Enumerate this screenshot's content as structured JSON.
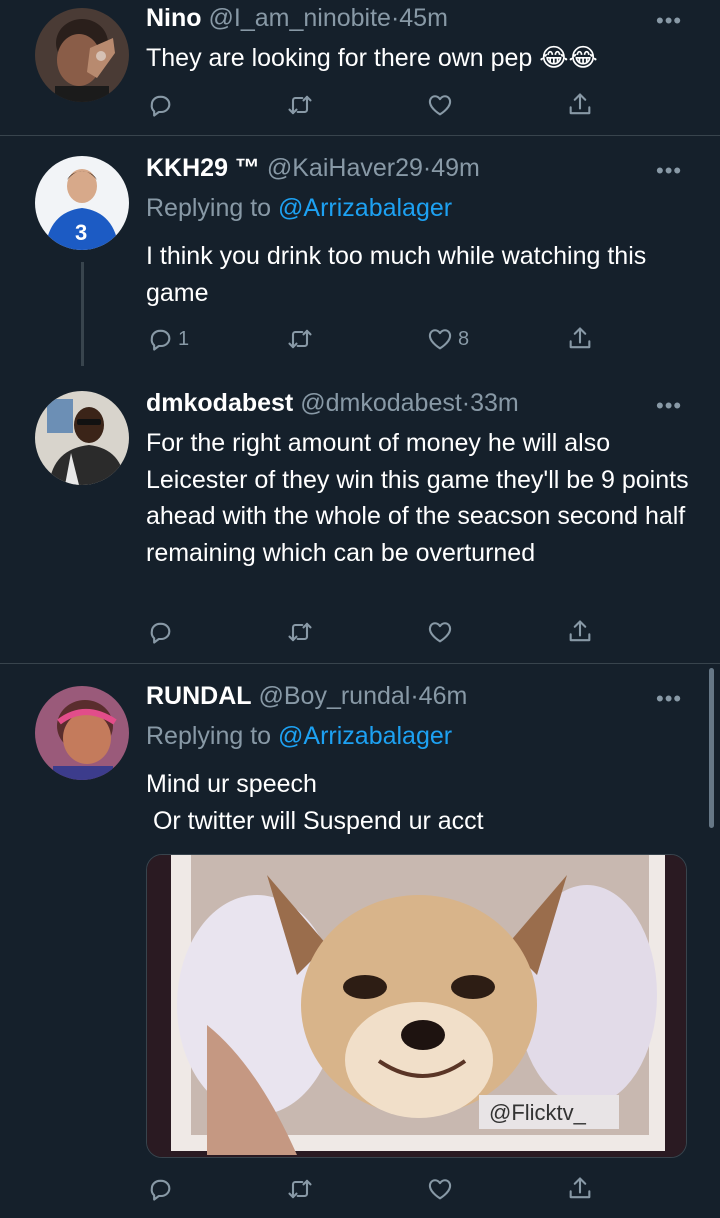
{
  "colors": {
    "background": "#15202b",
    "text": "#ffffff",
    "muted": "#8899a6",
    "link": "#1da1f2",
    "divider": "#38444d"
  },
  "tweets": [
    {
      "display_name": "Nino",
      "handle": "@I_am_ninobite",
      "time": "·45m",
      "text": "They are looking for there own pep 😂😂",
      "replies": "",
      "retweets": "",
      "likes": ""
    },
    {
      "display_name": "KKH29 ™",
      "handle": "@KaiHaver29",
      "time": "·49m",
      "reply_prefix": "Replying to ",
      "reply_to": "@Arrizabalager",
      "text": "I think you drink too much while watching this game",
      "replies": "1",
      "retweets": "",
      "likes": "8"
    },
    {
      "display_name": "dmkodabest",
      "handle": "@dmkodabest",
      "time": "·33m",
      "text": "For the right amount of money he will also Leicester of they win this game they'll be 9 points ahead with the whole of the seacson second half remaining which can be overturned",
      "replies": "",
      "retweets": "",
      "likes": ""
    },
    {
      "display_name": "RUNDAL",
      "handle": "@Boy_rundal",
      "time": "·46m",
      "reply_prefix": "Replying to ",
      "reply_to": "@Arrizabalager",
      "text": "Mind ur speech\n Or twitter will Suspend ur acct",
      "media_watermark": "@Flicktv_",
      "replies": "",
      "retweets": "",
      "likes": ""
    }
  ],
  "icons": {
    "more": "more-horizontal-icon",
    "reply": "reply-icon",
    "retweet": "retweet-icon",
    "like": "heart-icon",
    "share": "share-icon"
  },
  "more_glyph": "•••"
}
